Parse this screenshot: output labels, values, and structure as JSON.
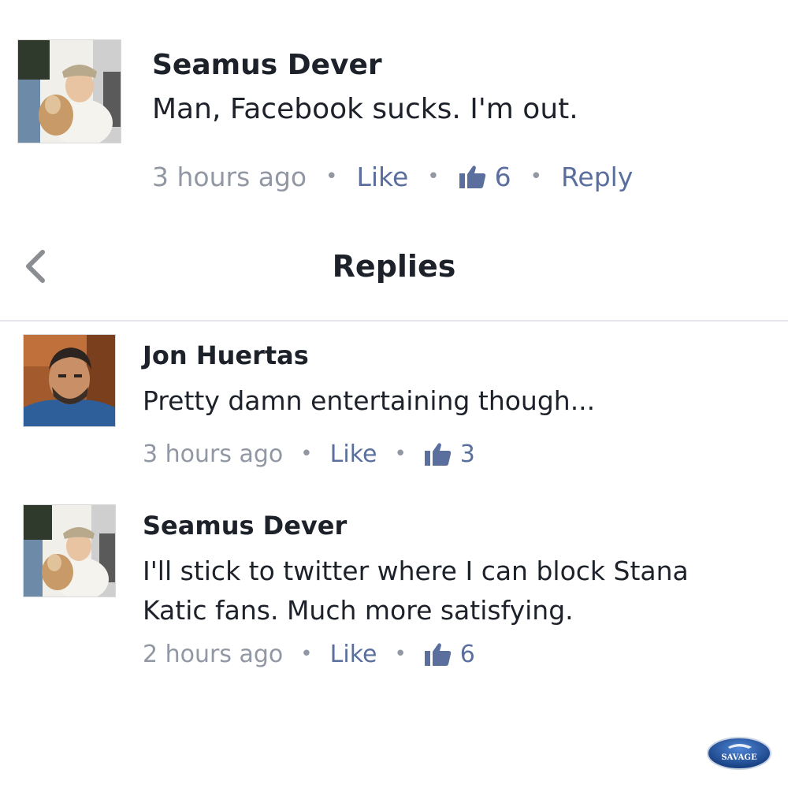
{
  "comment": {
    "author": "Seamus Dever",
    "text": "Man, Facebook sucks. I'm out.",
    "time": "3 hours ago",
    "like_label": "Like",
    "like_count": "6",
    "reply_label": "Reply"
  },
  "replies_header": {
    "title": "Replies",
    "back_icon": "chevron-left-icon"
  },
  "replies": [
    {
      "author": "Jon Huertas",
      "text": "Pretty damn entertaining though...",
      "time": "3 hours ago",
      "like_label": "Like",
      "like_count": "3"
    },
    {
      "author": "Seamus Dever",
      "text": "I'll stick to twitter where I can block Stana Katic fans. Much more satisfying.",
      "time": "2 hours ago",
      "like_label": "Like",
      "like_count": "6"
    }
  ],
  "watermark": {
    "text": "SAVAGE"
  },
  "colors": {
    "text": "#1d2129",
    "meta_gray": "#9197a3",
    "link_blue": "#5b6f9e",
    "divider": "#e3e5ea",
    "logo_blue": "#1f4e9c"
  }
}
